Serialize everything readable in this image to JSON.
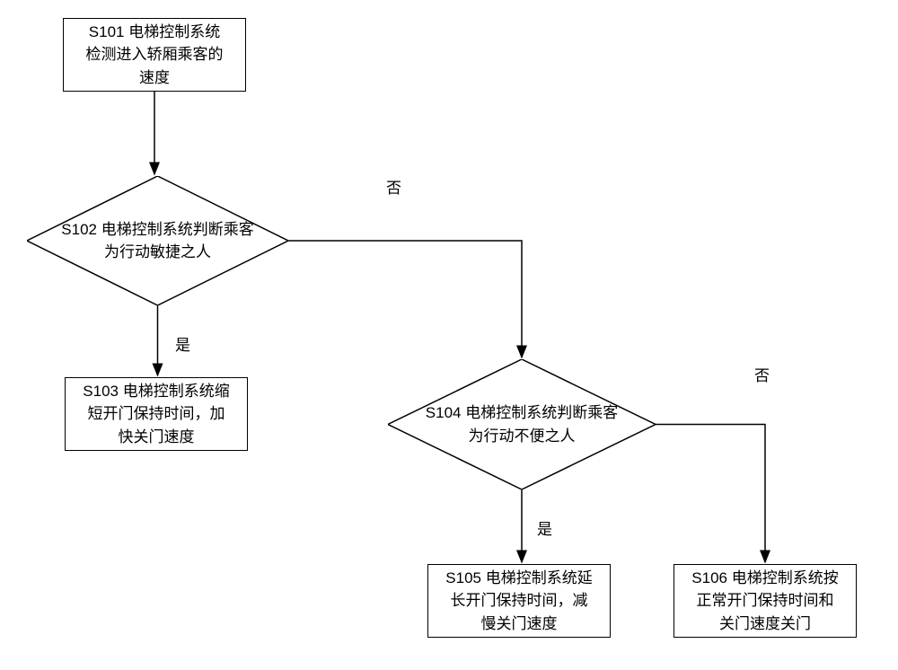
{
  "nodes": {
    "s101": "S101  电梯控制系统\n检测进入轿厢乘客的\n速度",
    "s102": "S102  电梯控制系统判断乘客\n为行动敏捷之人",
    "s103": "S103  电梯控制系统缩\n短开门保持时间，加\n快关门速度",
    "s104": "S104  电梯控制系统判断乘客\n为行动不便之人",
    "s105": "S105  电梯控制系统延\n长开门保持时间，减\n慢关门速度",
    "s106": "S106  电梯控制系统按\n正常开门保持时间和\n关门速度关门"
  },
  "labels": {
    "yes": "是",
    "no": "否"
  }
}
